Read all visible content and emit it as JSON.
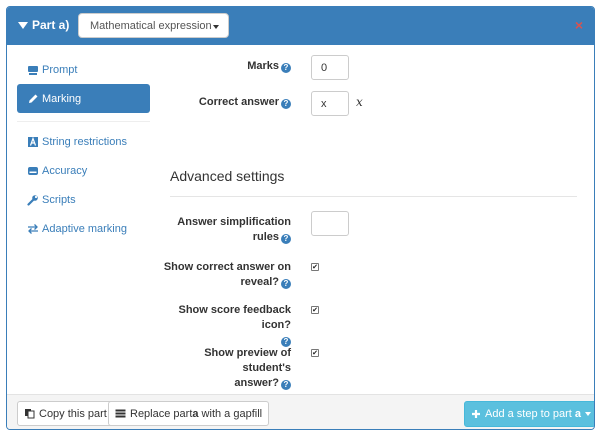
{
  "header": {
    "part_label": "Part a)",
    "part_type": "Mathematical expression",
    "delete_glyph": "×"
  },
  "nav": {
    "items": [
      {
        "label": "Prompt",
        "icon": "card-icon",
        "active": false
      },
      {
        "label": "Marking",
        "icon": "pencil-icon",
        "active": true
      },
      {
        "label": "String restrictions",
        "icon": "letter-a-icon",
        "active": false
      },
      {
        "label": "Accuracy",
        "icon": "drive-icon",
        "active": false
      },
      {
        "label": "Scripts",
        "icon": "wrench-icon",
        "active": false
      },
      {
        "label": "Adaptive marking",
        "icon": "swap-icon",
        "active": false
      }
    ]
  },
  "marking": {
    "marks_label": "Marks",
    "marks_value": "0",
    "correct_answer_label": "Correct answer",
    "correct_answer_value": "x",
    "correct_answer_rendered": "x"
  },
  "advanced": {
    "title": "Advanced settings",
    "simplification_label_line1": "Answer simplification",
    "simplification_label_line2": "rules",
    "simplification_value": "",
    "show_answer_label_line1": "Show correct answer on",
    "show_answer_label_line2": "reveal?",
    "show_answer_checked": true,
    "score_icon_label_line1": "Show score feedback icon?",
    "score_icon_checked": true,
    "preview_label_line1": "Show preview of student's",
    "preview_label_line2": "answer?",
    "preview_checked": true,
    "check_glyph": "✔",
    "help_glyph": "?"
  },
  "footer": {
    "copy_label": "Copy this part",
    "replace_prefix": "Replace part ",
    "replace_part": "a",
    "replace_suffix": " with a gapfill",
    "add_step_prefix": "Add a step to part ",
    "add_step_part": "a"
  },
  "colors": {
    "primary": "#3a7eb9",
    "info": "#5bc0de",
    "danger": "#d9534f"
  }
}
